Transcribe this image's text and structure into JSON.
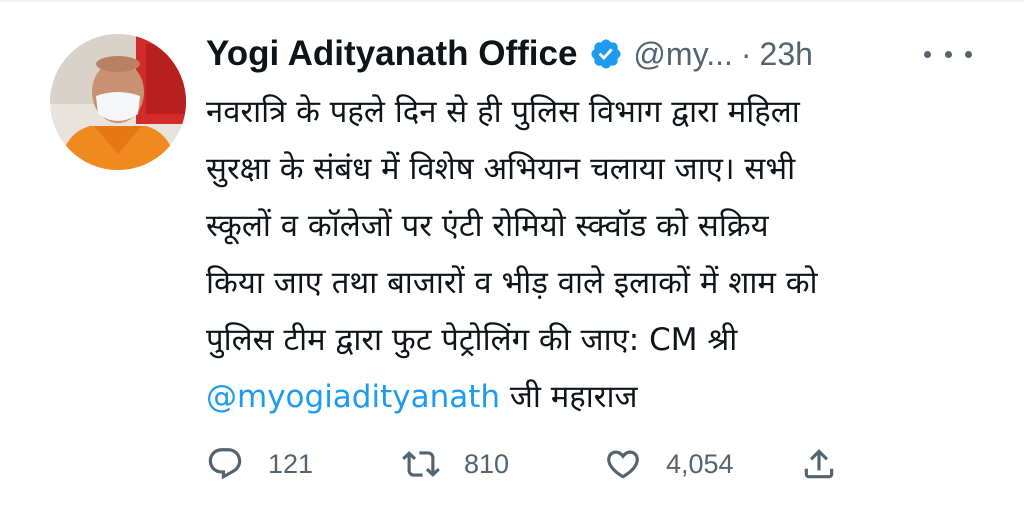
{
  "tweet": {
    "author_name": "Yogi Adityanath Office",
    "handle": "@my...",
    "separator": "·",
    "time": "23h",
    "text_lines": [
      "नवरात्रि के पहले दिन से ही पुलिस विभाग द्वारा महिला",
      "सुरक्षा के संबंध में विशेष अभियान चलाया जाए। सभी",
      "स्कूलों व कॉलेजों पर एंटी रोमियो स्क्वॉड को सक्रिय",
      "किया जाए तथा बाजारों व भीड़ वाले इलाकों में शाम को",
      "पुलिस टीम द्वारा फुट पेट्रोलिंग की जाए: CM श्री"
    ],
    "mention": "@myogiadityanath",
    "last_line_suffix": " जी महाराज"
  },
  "actions": {
    "replies": "121",
    "retweets": "810",
    "likes": "4,054"
  },
  "icons": {
    "verified": "verified-badge-icon",
    "more": "more-icon",
    "reply": "reply-icon",
    "retweet": "retweet-icon",
    "like": "heart-icon",
    "share": "share-icon"
  },
  "colors": {
    "accent": "#1d9bf0",
    "text": "#0f1419",
    "secondary": "#536471"
  }
}
